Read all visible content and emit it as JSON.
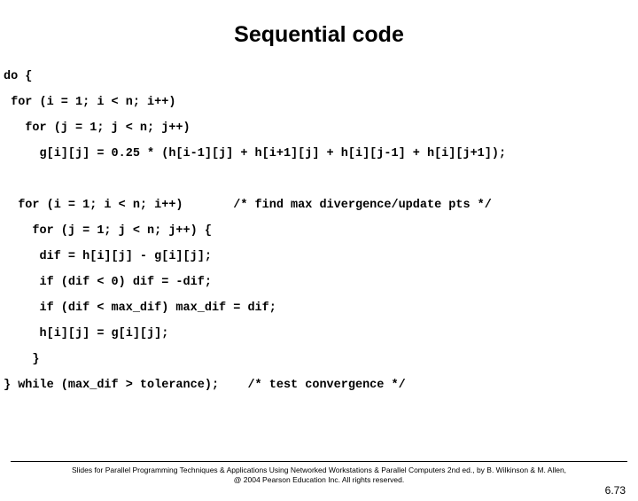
{
  "title": "Sequential code",
  "code": {
    "l1": "do {",
    "l2": " for (i = 1; i < n; i++)",
    "l3": "   for (j = 1; j < n; j++)",
    "l4": "     g[i][j] = 0.25 * (h[i-1][j] + h[i+1][j] + h[i][j-1] + h[i][j+1]);",
    "l5": "",
    "l6": "  for (i = 1; i < n; i++)       /* find max divergence/update pts */",
    "l7": "    for (j = 1; j < n; j++) {",
    "l8": "     dif = h[i][j] - g[i][j];",
    "l9": "     if (dif < 0) dif = -dif;",
    "l10": "     if (dif < max_dif) max_dif = dif;",
    "l11": "     h[i][j] = g[i][j];",
    "l12": "    }",
    "l13": "} while (max_dif > tolerance);    /* test convergence */"
  },
  "footer": {
    "line1": "Slides for Parallel Programming Techniques & Applications Using Networked Workstations & Parallel Computers 2nd ed., by B. Wilkinson & M. Allen,",
    "line2": "@ 2004 Pearson Education Inc. All rights reserved."
  },
  "page_number": "6.73"
}
